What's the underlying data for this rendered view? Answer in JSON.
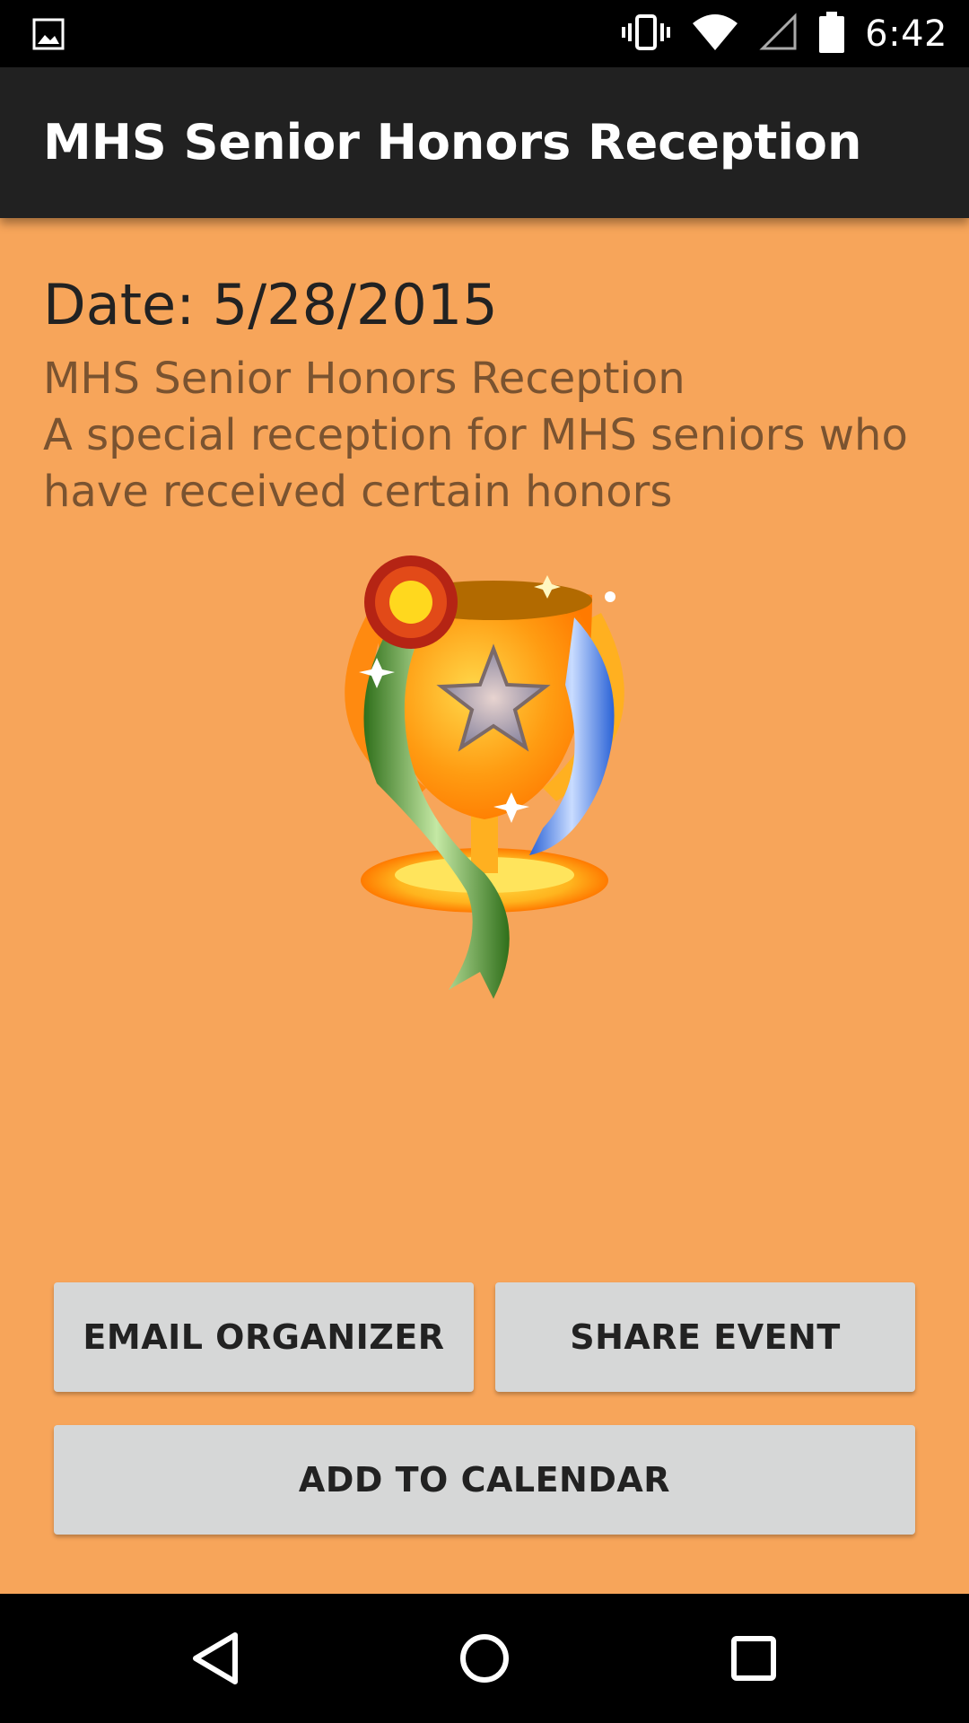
{
  "status_bar": {
    "time": "6:42",
    "icons": [
      "image-notification-icon",
      "vibrate-icon",
      "wifi-icon",
      "cellular-signal-icon",
      "battery-icon"
    ]
  },
  "app_bar": {
    "title": "MHS Senior Honors Reception"
  },
  "event": {
    "date_text": "Date: 5/28/2015",
    "description_lines": [
      "MHS Senior Honors Reception",
      "A special reception for MHS seniors who have received certain honors"
    ],
    "image_icon": "trophy-icon"
  },
  "buttons": {
    "email_label": "EMAIL ORGANIZER",
    "share_label": "SHARE EVENT",
    "calendar_label": "ADD TO CALENDAR"
  },
  "nav_bar": {
    "icons": [
      "back-icon",
      "home-icon",
      "recents-icon"
    ]
  },
  "colors": {
    "background": "#f7a55a",
    "app_bar": "#212121",
    "button": "#d6d7d7",
    "description_text": "#7a5330"
  }
}
